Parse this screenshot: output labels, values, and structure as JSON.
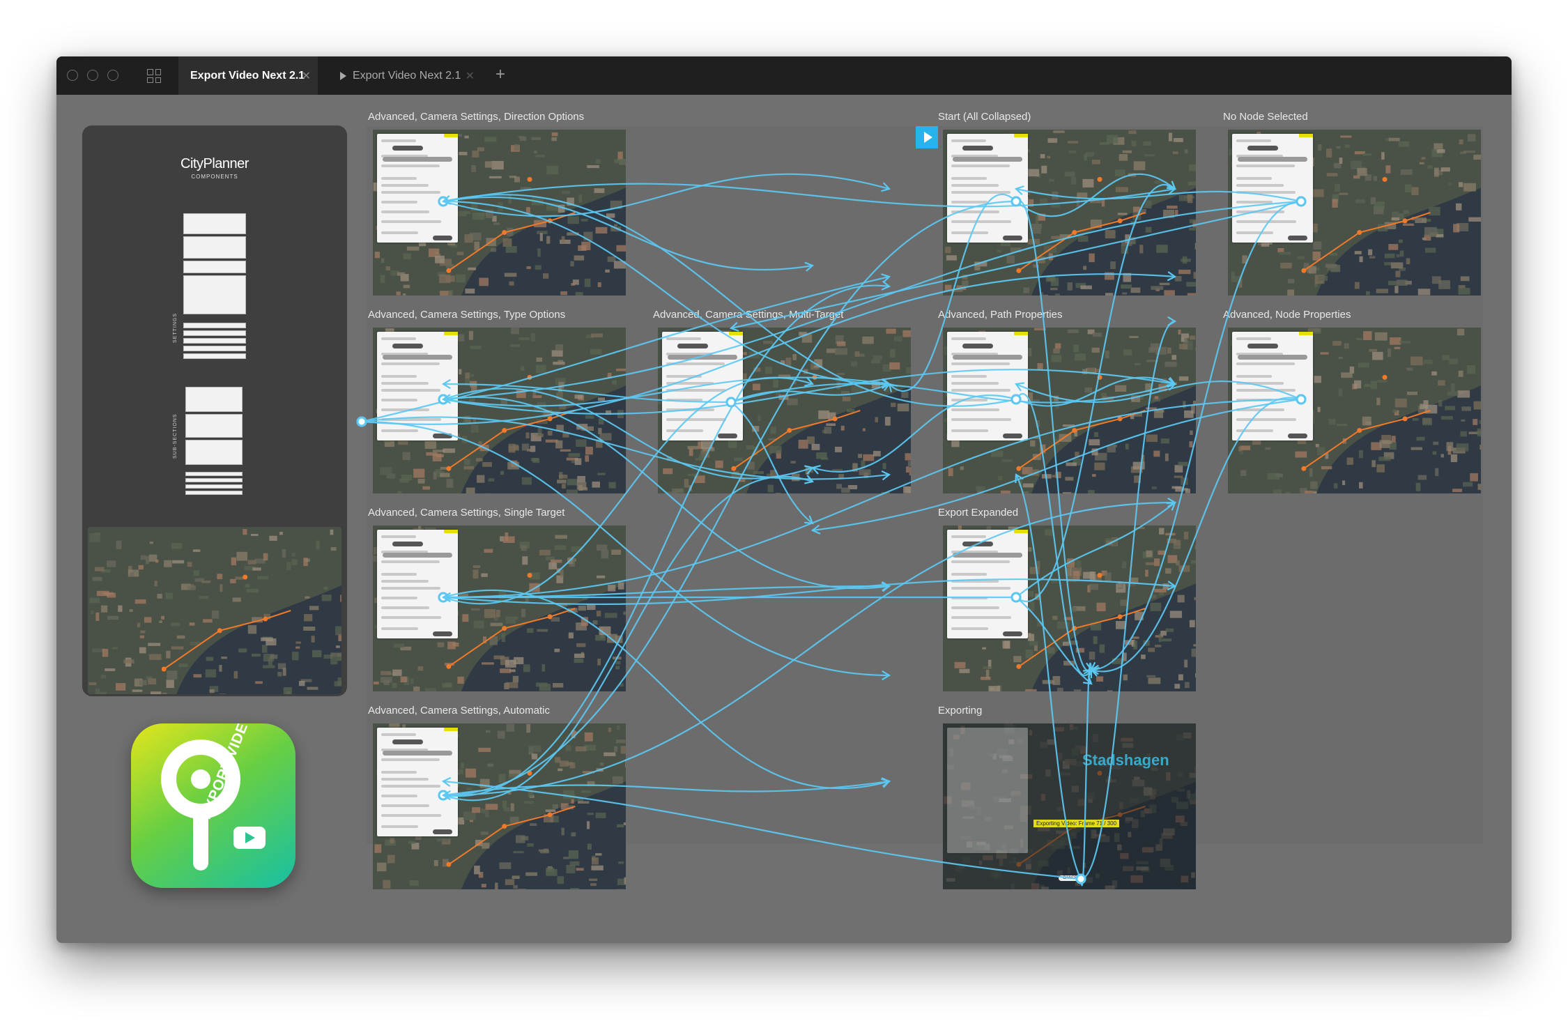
{
  "window": {
    "tabs": [
      {
        "label": "Export Video Next 2.1",
        "active": true
      },
      {
        "label": "Export Video Next 2.1",
        "active": false
      }
    ],
    "new_tab_label": "+"
  },
  "sidebar": {
    "logo_main": "City",
    "logo_accent": "Planner",
    "logo_sub": "COMPONENTS",
    "label_settings": "SETTINGS",
    "label_subsections": "SUB-SECTIONS"
  },
  "app_icon": {
    "text": "EXPORT VIDEO",
    "colors": [
      "#e4e61b",
      "#69cf42",
      "#17c0a4"
    ]
  },
  "screens": [
    {
      "title": "Advanced, Camera Settings, Direction Options"
    },
    {
      "title": "Advanced, Camera Settings, Type Options"
    },
    {
      "title": "Advanced, Camera Settings, Single Target"
    },
    {
      "title": "Advanced, Camera Settings, Automatic"
    },
    {
      "title": "Advanced, Camera Settings, Multi-Target"
    },
    {
      "title": "Start (All Collapsed)"
    },
    {
      "title": "Advanced, Path Properties"
    },
    {
      "title": "Export Expanded"
    },
    {
      "title": "Exporting"
    },
    {
      "title": "No Node Selected"
    },
    {
      "title": "Advanced, Node Properties"
    }
  ],
  "exporting": {
    "caption": "Exporting Video: Frame 71 / 300",
    "map_label": "Stadshagen",
    "cancel_label": "CANCEL"
  },
  "colors": {
    "link": "#5cc8f2",
    "canvas": "#6c6c6c",
    "window": "#707070",
    "titlebar": "#1f1f1f",
    "accent_play": "#27b3ec"
  }
}
